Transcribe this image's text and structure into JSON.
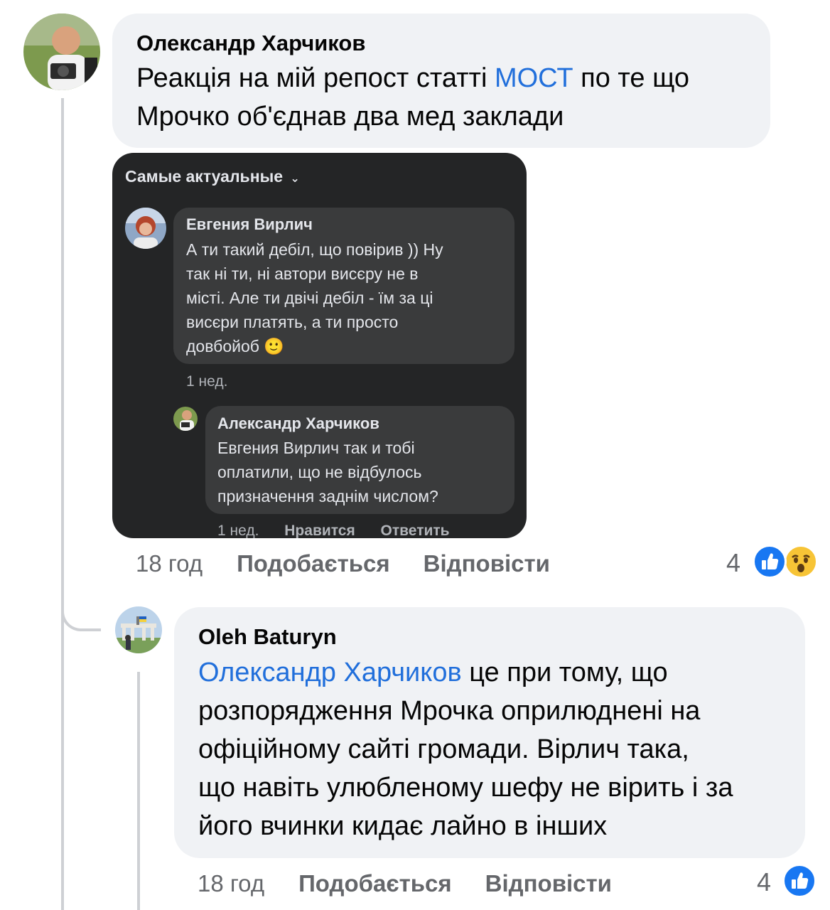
{
  "comment1": {
    "author": "Олександр Харчиков",
    "text_line1_pre": "Реакція на мій репост статті ",
    "text_line1_link": "МОСТ",
    "text_line1_post": " по те що",
    "text_line2": "Мрочко об'єднав два мед заклади",
    "time": "18 год",
    "like_label": "Подобається",
    "reply_label": "Відповісти",
    "reactions_count": "4",
    "reactions": [
      "like-icon",
      "wow-icon"
    ]
  },
  "screenshot": {
    "sort_label": "Самые актуальные",
    "c1_author": "Евгения Вирлич",
    "c1_lines": [
      "А ти такий дебіл, що повірив )) Ну",
      "так ні ти, ні автори висєру не в",
      "місті. Але ти двічі дебіл - їм за ці",
      "висєри платять, а ти просто",
      "довбойоб"
    ],
    "c1_emoji": "🙂",
    "c1_time": "1 нед.",
    "c2_author": "Александр Харчиков",
    "c2_lines": [
      "Евгения Вирлич так и тобі",
      "оплатили, що не відбулось",
      "призначення заднім числом?"
    ],
    "c2_time": "1 нед.",
    "c2_like": "Нравится",
    "c2_reply": "Ответить"
  },
  "comment2": {
    "author": "Oleh Baturyn",
    "mention": "Олександр Харчиков",
    "line1_rest": " це при тому, що",
    "line2": "розпорядження Мрочка оприлюднені на",
    "line3": "офіційному сайті громади. Вірлич така,",
    "line4": "що навіть улюбленому шефу не вірить і за",
    "line5": "його вчинки кидає лайно в інших",
    "time": "18 год",
    "like_label": "Подобається",
    "reply_label": "Відповісти",
    "reactions_count": "4",
    "reactions": [
      "like-icon"
    ]
  },
  "colors": {
    "link": "#216fdb",
    "bubble": "#f0f2f5",
    "like_blue": "#1877f2",
    "wow_yellow": "#f7c436"
  }
}
